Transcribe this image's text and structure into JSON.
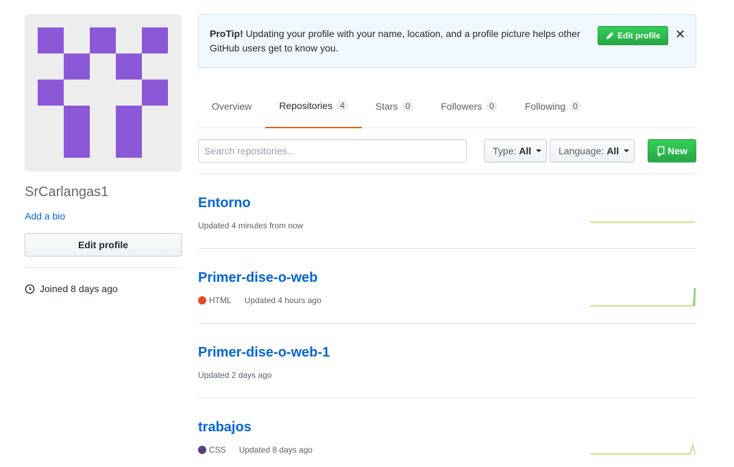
{
  "profile": {
    "username": "SrCarlangas1",
    "add_bio": "Add a bio",
    "edit_profile": "Edit profile",
    "joined": "Joined 8 days ago",
    "avatar_color": "#8b58d8"
  },
  "protip": {
    "label": "ProTip!",
    "text": " Updating your profile with your name, location, and a profile picture helps other GitHub users get to know you.",
    "button": "Edit profile",
    "close": "✕"
  },
  "tabs": [
    {
      "label": "Overview",
      "count": null
    },
    {
      "label": "Repositories",
      "count": "4"
    },
    {
      "label": "Stars",
      "count": "0"
    },
    {
      "label": "Followers",
      "count": "0"
    },
    {
      "label": "Following",
      "count": "0"
    }
  ],
  "filters": {
    "search_placeholder": "Search repositories...",
    "type_label": "Type:",
    "type_value": "All",
    "language_label": "Language:",
    "language_value": "All",
    "new_button": "New"
  },
  "repos": [
    {
      "name": "Entorno",
      "language": null,
      "language_color": null,
      "updated": "Updated 4 minutes from now",
      "spark": "flat"
    },
    {
      "name": "Primer-dise-o-web",
      "language": "HTML",
      "language_color": "#e34c26",
      "updated": "Updated 4 hours ago",
      "spark": "spike"
    },
    {
      "name": "Primer-dise-o-web-1",
      "language": null,
      "language_color": null,
      "updated": "Updated 2 days ago",
      "spark": "none"
    },
    {
      "name": "trabajos",
      "language": "CSS",
      "language_color": "#563d7c",
      "updated": "Updated 8 days ago",
      "spark": "bump"
    }
  ]
}
